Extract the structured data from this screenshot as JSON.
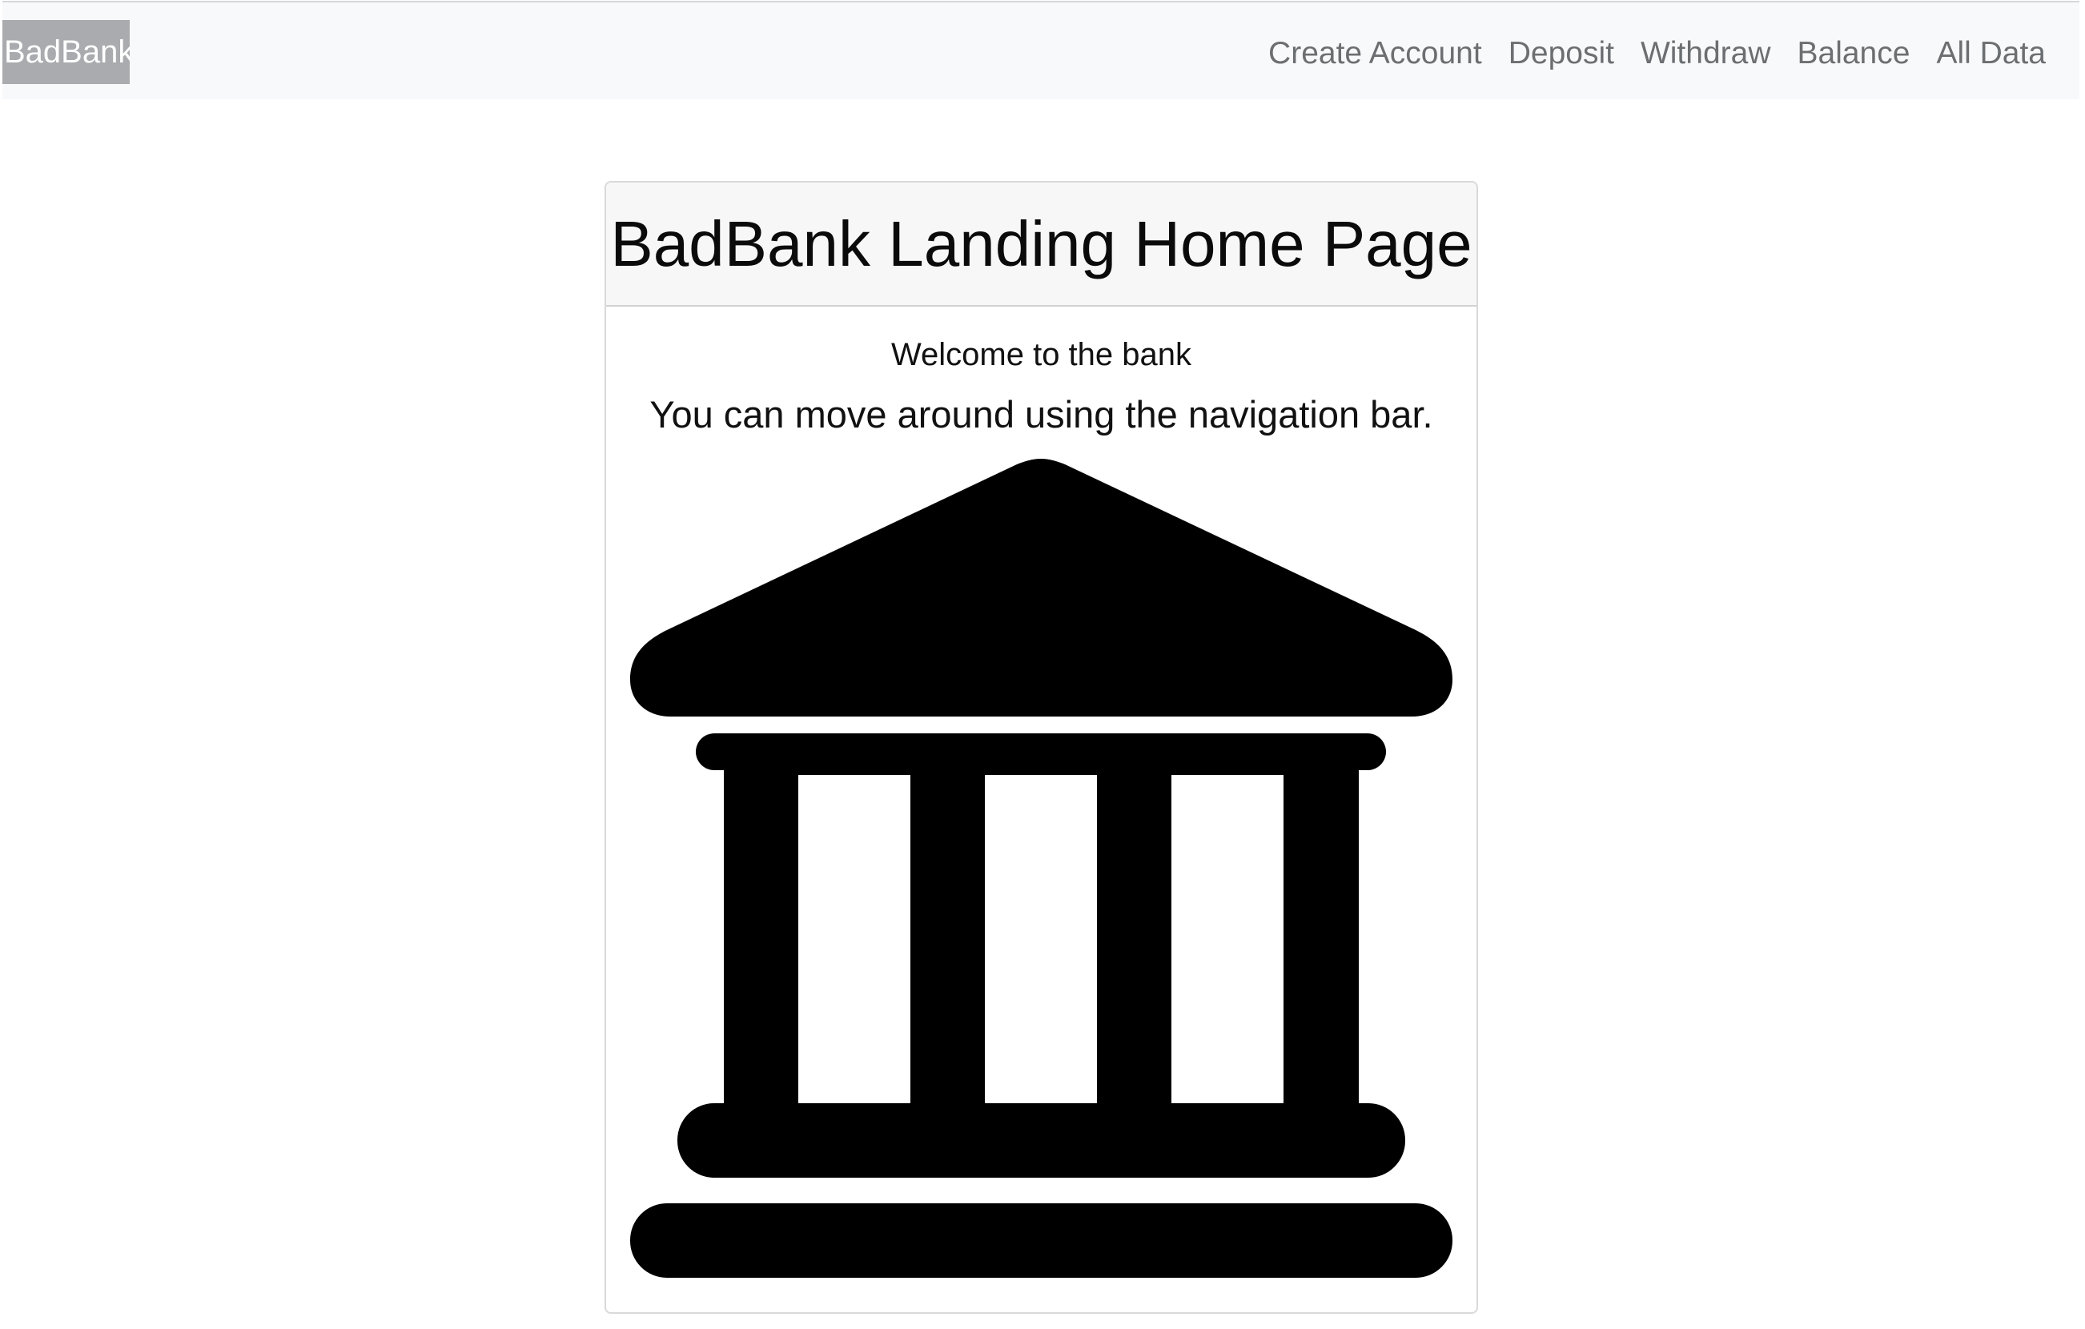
{
  "navbar": {
    "brand": "BadBank",
    "links": [
      {
        "label": "Create Account"
      },
      {
        "label": "Deposit"
      },
      {
        "label": "Withdraw"
      },
      {
        "label": "Balance"
      },
      {
        "label": "All Data"
      }
    ]
  },
  "card": {
    "title": "BadBank Landing Home Page",
    "welcome": "Welcome to the bank",
    "instruction": "You can move around using the navigation bar.",
    "icon": "bank-building-icon"
  },
  "colors": {
    "navbar_bg": "#f8f9fa",
    "brand_bg": "#a9abae",
    "brand_text": "#ffffff",
    "nav_link": "#6c6f72",
    "card_header_bg": "#f7f7f7",
    "icon_fill": "#000000"
  }
}
